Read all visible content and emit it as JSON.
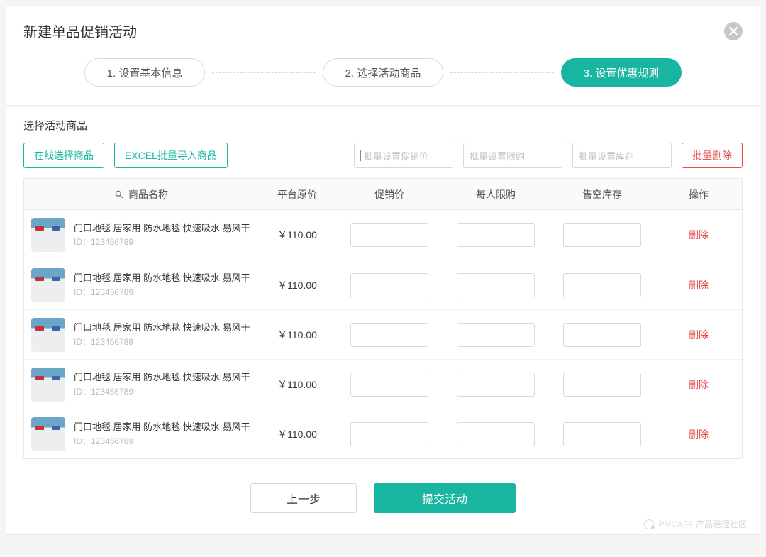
{
  "modal": {
    "title": "新建单品促销活动"
  },
  "steps": {
    "s1": "1. 设置基本信息",
    "s2": "2. 选择活动商品",
    "s3": "3. 设置优惠规则"
  },
  "section": {
    "title": "选择活动商品"
  },
  "toolbar": {
    "select_online": "在线选择商品",
    "excel_import": "EXCEL批量导入商品",
    "batch_promo_placeholder": "批量设置促销价",
    "batch_limit_placeholder": "批量设置限购",
    "batch_stock_placeholder": "批量设置库存",
    "batch_delete": "批量删除"
  },
  "table": {
    "headers": {
      "name": "商品名称",
      "price": "平台原价",
      "promo": "促销价",
      "limit": "每人限购",
      "stock": "售空库存",
      "op": "操作"
    },
    "id_prefix": "ID：",
    "delete_label": "删除",
    "rows": [
      {
        "name": "门口地毯 居家用 防水地毯 快速吸水 易风干",
        "id": "123456789",
        "price": "￥110.00"
      },
      {
        "name": "门口地毯 居家用 防水地毯 快速吸水 易风干",
        "id": "123456789",
        "price": "￥110.00"
      },
      {
        "name": "门口地毯 居家用 防水地毯 快速吸水 易风干",
        "id": "123456789",
        "price": "￥110.00"
      },
      {
        "name": "门口地毯 居家用 防水地毯 快速吸水 易风干",
        "id": "123456789",
        "price": "￥110.00"
      },
      {
        "name": "门口地毯 居家用 防水地毯 快速吸水 易风干",
        "id": "123456789",
        "price": "￥110.00"
      }
    ]
  },
  "footer": {
    "prev": "上一步",
    "submit": "提交活动"
  },
  "brand": {
    "note": "PMCAFF 产品经理社区"
  }
}
